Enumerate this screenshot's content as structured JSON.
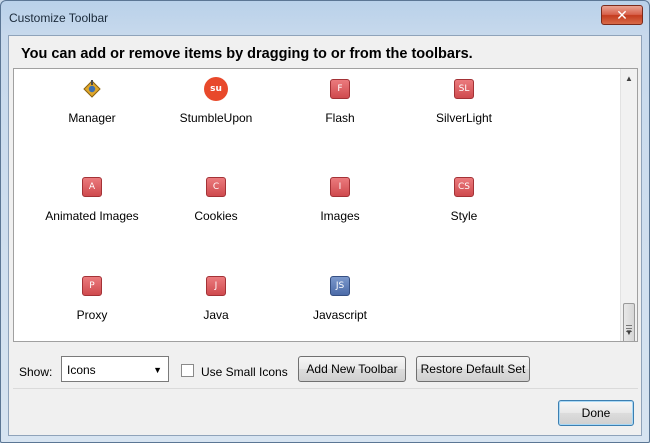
{
  "window": {
    "title": "Customize Toolbar",
    "close_glyph": "✕"
  },
  "instruction": "You can add or remove items by dragging to or from the toolbars.",
  "palette": {
    "items": [
      {
        "label": "Manager",
        "icon": "manager-icon",
        "glyph": ""
      },
      {
        "label": "StumbleUpon",
        "icon": "stumbleupon-icon",
        "glyph": "su"
      },
      {
        "label": "Flash",
        "icon": "flash-icon",
        "glyph": "F"
      },
      {
        "label": "SilverLight",
        "icon": "silverlight-icon",
        "glyph": "SL"
      },
      {
        "label": "Animated Images",
        "icon": "animated-images-icon",
        "glyph": "A"
      },
      {
        "label": "Cookies",
        "icon": "cookies-icon",
        "glyph": "C"
      },
      {
        "label": "Images",
        "icon": "images-icon",
        "glyph": "I"
      },
      {
        "label": "Style",
        "icon": "style-icon",
        "glyph": "CS"
      },
      {
        "label": "Proxy",
        "icon": "proxy-icon",
        "glyph": "P"
      },
      {
        "label": "Java",
        "icon": "java-icon",
        "glyph": "J"
      },
      {
        "label": "Javascript",
        "icon": "javascript-icon",
        "glyph": "JS"
      }
    ]
  },
  "controls": {
    "show_label": "Show:",
    "show_value": "Icons",
    "small_icons_label": "Use Small Icons",
    "small_icons_checked": false,
    "add_toolbar_label": "Add New Toolbar",
    "restore_label": "Restore Default Set",
    "done_label": "Done"
  },
  "colors": {
    "badge_red": "#cf4a4e",
    "badge_blue": "#4c6ba8",
    "stumbleupon": "#e8492b"
  }
}
